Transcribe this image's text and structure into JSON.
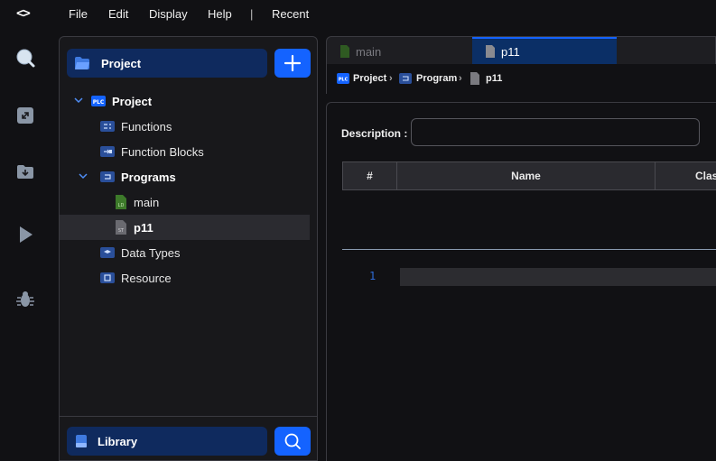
{
  "menu": {
    "logo": "<>",
    "items": [
      "File",
      "Edit",
      "Display",
      "Help"
    ],
    "separator": "|",
    "recent": "Recent"
  },
  "activity": [
    "search-icon",
    "expand-icon",
    "download-icon",
    "run-icon",
    "debug-icon"
  ],
  "explorer": {
    "project_header": "Project",
    "tree": [
      {
        "label": "Project",
        "badge": "PLC",
        "bold": true,
        "selected": false
      },
      {
        "label": "Functions",
        "bold": false,
        "selected": false
      },
      {
        "label": "Function Blocks",
        "bold": false,
        "selected": false
      },
      {
        "label": "Programs",
        "bold": true,
        "selected": false
      },
      {
        "label": "main",
        "bold": false,
        "selected": false,
        "file_tag": "LD"
      },
      {
        "label": "p11",
        "bold": true,
        "selected": true,
        "file_tag": "ST"
      },
      {
        "label": "Data Types",
        "bold": false,
        "selected": false
      },
      {
        "label": "Resource",
        "bold": false,
        "selected": false
      }
    ],
    "library_header": "Library"
  },
  "tabs": [
    {
      "label": "main",
      "active": false
    },
    {
      "label": "p11",
      "active": true
    }
  ],
  "breadcrumb": {
    "items": [
      "Project",
      "Program",
      "p11"
    ],
    "badge": "PLC"
  },
  "editor": {
    "description_label": "Description :",
    "description_value": "",
    "columns": [
      "#",
      "Name",
      "Clas"
    ],
    "line_number": "1"
  },
  "colors": {
    "accent": "#1463ff",
    "header_bg": "#0f2a5e",
    "ld_green": "#3d7a2a",
    "st_gray": "#6a6a70"
  }
}
